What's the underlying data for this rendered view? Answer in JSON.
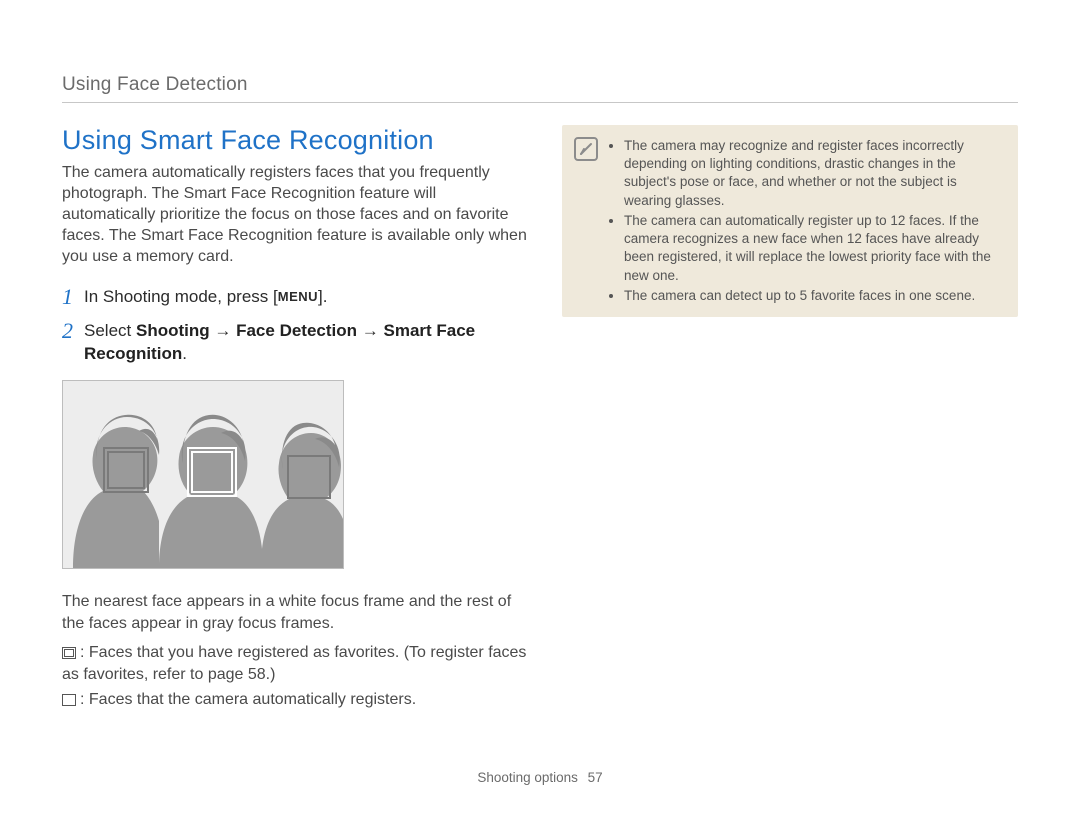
{
  "breadcrumb": "Using Face Detection",
  "title": "Using Smart Face Recognition",
  "intro": "The camera automatically registers faces that you frequently photograph. The Smart Face Recognition feature will automatically prioritize the focus on those faces and on favorite faces. The Smart Face Recognition feature is available only when you use a memory card.",
  "steps": {
    "s1_a": "In Shooting mode, press [",
    "s1_menu": "MENU",
    "s1_b": "].",
    "s2_a": "Select ",
    "s2_b": "Shooting",
    "s2_arr": " → ",
    "s2_c": "Face Detection",
    "s2_d": "Smart Face Recognition",
    "s2_e": "."
  },
  "caption": "The nearest face appears in a white focus frame and the rest of the faces appear in gray focus frames.",
  "bullets": {
    "b1": ": Faces that you have registered as favorites. (To register faces as favorites, refer to page 58.)",
    "b2": ": Faces that the camera automatically registers."
  },
  "notes": {
    "n1": "The camera may recognize and register faces incorrectly depending on lighting conditions, drastic changes in the subject's pose or face, and whether or not the subject is wearing glasses.",
    "n2": "The camera can automatically register up to 12 faces. If the camera recognizes a new face when 12 faces have already been registered, it will replace the lowest priority face with the new one.",
    "n3": "The camera can detect up to 5 favorite faces in one scene."
  },
  "footer": {
    "section": "Shooting options",
    "page": "57"
  }
}
